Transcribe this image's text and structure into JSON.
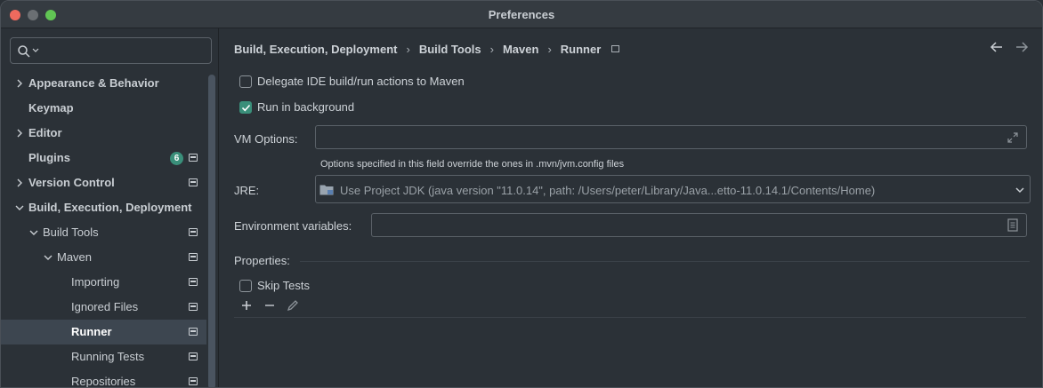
{
  "window": {
    "title": "Preferences"
  },
  "sidebar": {
    "search": {
      "placeholder": "",
      "value": ""
    },
    "items": [
      {
        "label": "Appearance & Behavior"
      },
      {
        "label": "Keymap"
      },
      {
        "label": "Editor"
      },
      {
        "label": "Plugins",
        "badge": "6"
      },
      {
        "label": "Version Control"
      },
      {
        "label": "Build, Execution, Deployment"
      },
      {
        "label": "Build Tools"
      },
      {
        "label": "Maven"
      },
      {
        "label": "Importing"
      },
      {
        "label": "Ignored Files"
      },
      {
        "label": "Runner"
      },
      {
        "label": "Running Tests"
      },
      {
        "label": "Repositories"
      }
    ]
  },
  "breadcrumb": [
    "Build, Execution, Deployment",
    "Build Tools",
    "Maven",
    "Runner"
  ],
  "form": {
    "delegate": {
      "label": "Delegate IDE build/run actions to Maven",
      "checked": false
    },
    "background": {
      "label": "Run in background",
      "checked": true
    },
    "vm_options": {
      "label": "VM Options:",
      "value": ""
    },
    "vm_hint": "Options specified in this field override the ones in .mvn/jvm.config files",
    "jre": {
      "label": "JRE:",
      "value": "Use Project JDK (java version \"11.0.14\", path: /Users/peter/Library/Java...etto-11.0.14.1/Contents/Home)"
    },
    "env": {
      "label": "Environment variables:",
      "value": ""
    },
    "properties_label": "Properties:",
    "skip_tests": {
      "label": "Skip Tests",
      "checked": false
    }
  },
  "colors": {
    "accent": "#3a8f7a",
    "background": "#2b3137",
    "selected": "#3d4650"
  },
  "icons": [
    "search-icon",
    "chevron-right-icon",
    "chevron-down-icon",
    "page-icon",
    "arrow-left-icon",
    "arrow-right-icon",
    "expand-icon",
    "folder-icon",
    "dropdown-icon",
    "document-icon",
    "plus-icon",
    "minus-icon",
    "pencil-icon"
  ]
}
